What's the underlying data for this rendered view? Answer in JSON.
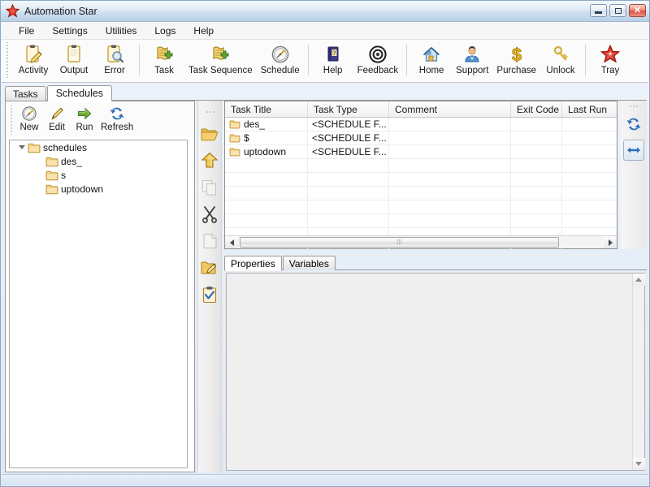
{
  "window": {
    "title": "Automation Star",
    "app_icon": "red-star-icon",
    "buttons": {
      "minimize": "minimize-icon",
      "maximize": "maximize-icon",
      "close": "close-icon"
    }
  },
  "menubar": {
    "items": [
      {
        "label": "File"
      },
      {
        "label": "Settings"
      },
      {
        "label": "Utilities"
      },
      {
        "label": "Logs"
      },
      {
        "label": "Help"
      }
    ]
  },
  "toolbar": {
    "groups": [
      {
        "buttons": [
          {
            "label": "Activity",
            "icon": "clipboard-pencil-icon"
          },
          {
            "label": "Output",
            "icon": "clipboard-icon"
          },
          {
            "label": "Error",
            "icon": "clipboard-magnifier-icon"
          }
        ]
      },
      {
        "buttons": [
          {
            "label": "Task",
            "icon": "new-task-icon"
          },
          {
            "label": "Task Sequence",
            "icon": "new-task-sequence-icon"
          },
          {
            "label": "Schedule",
            "icon": "schedule-clock-icon"
          }
        ]
      },
      {
        "buttons": [
          {
            "label": "Help",
            "icon": "help-book-icon"
          },
          {
            "label": "Feedback",
            "icon": "feedback-target-icon"
          }
        ]
      },
      {
        "buttons": [
          {
            "label": "Home",
            "icon": "home-icon"
          },
          {
            "label": "Support",
            "icon": "support-person-icon"
          },
          {
            "label": "Purchase",
            "icon": "dollar-icon"
          },
          {
            "label": "Unlock",
            "icon": "key-icon"
          }
        ]
      },
      {
        "buttons": [
          {
            "label": "Tray",
            "icon": "red-star-icon"
          }
        ]
      }
    ]
  },
  "main_tabs": {
    "items": [
      {
        "label": "Tasks",
        "active": false
      },
      {
        "label": "Schedules",
        "active": true
      }
    ]
  },
  "tree_panel": {
    "toolbar": [
      {
        "label": "New",
        "icon": "schedule-clock-icon"
      },
      {
        "label": "Edit",
        "icon": "pencil-icon"
      },
      {
        "label": "Run",
        "icon": "green-arrow-right-icon"
      },
      {
        "label": "Refresh",
        "icon": "blue-refresh-icon"
      }
    ],
    "tree": {
      "root": {
        "label": "schedules",
        "expanded": true,
        "icon": "folder-icon"
      },
      "children": [
        {
          "label": "des_",
          "icon": "folder-icon"
        },
        {
          "label": "s",
          "icon": "folder-icon"
        },
        {
          "label": "uptodown",
          "icon": "folder-icon"
        }
      ]
    }
  },
  "vertical_toolstrip": {
    "buttons": [
      {
        "name": "open-folder",
        "icon": "folder-open-icon",
        "enabled": true
      },
      {
        "name": "move-up",
        "icon": "yellow-up-arrow-icon",
        "enabled": true
      },
      {
        "name": "copy",
        "icon": "copy-pages-icon",
        "enabled": false
      },
      {
        "name": "cut",
        "icon": "scissors-icon",
        "enabled": true
      },
      {
        "name": "paste",
        "icon": "paste-page-icon",
        "enabled": false
      },
      {
        "name": "rename-folder",
        "icon": "folder-edit-icon",
        "enabled": true
      },
      {
        "name": "checklist",
        "icon": "clipboard-check-icon",
        "enabled": true
      }
    ]
  },
  "grid": {
    "columns": [
      "Task Title",
      "Task Type",
      "Comment",
      "Exit Code",
      "Last Run"
    ],
    "rows": [
      {
        "task_title": "des_",
        "task_type": "<SCHEDULE F...",
        "comment": "",
        "exit_code": "",
        "last_run": "",
        "icon": "folder-icon"
      },
      {
        "task_title": "$",
        "task_type": "<SCHEDULE F...",
        "comment": "",
        "exit_code": "",
        "last_run": "",
        "icon": "folder-icon"
      },
      {
        "task_title": "uptodown",
        "task_type": "<SCHEDULE F...",
        "comment": "",
        "exit_code": "",
        "last_run": "",
        "icon": "folder-icon"
      }
    ],
    "hscrollbar": {
      "left_arrow": "triangle-left-icon",
      "right_arrow": "triangle-right-icon",
      "thumb_grip": "⁞⁞⁞"
    }
  },
  "grid_toolstrip": {
    "buttons": [
      {
        "name": "refresh-grid",
        "icon": "blue-refresh-icon",
        "enabled": true
      },
      {
        "name": "autofit-columns",
        "icon": "blue-resize-width-icon",
        "enabled": true,
        "pressed": true
      }
    ]
  },
  "properties_panel": {
    "tabs": [
      {
        "label": "Properties",
        "active": true
      },
      {
        "label": "Variables",
        "active": false
      }
    ],
    "content": "",
    "scrollbar": {
      "up_arrow": "triangle-up-icon",
      "down_arrow": "triangle-down-icon"
    }
  },
  "statusbar": {
    "text": ""
  },
  "colors": {
    "title_gradient_top": "#f4f8fc",
    "title_gradient_bottom": "#b9cfe6",
    "accent_red": "#d9291c",
    "folder_yellow": "#f0c04a",
    "blue_accent": "#2a6fbd",
    "green_arrow": "#6aa832",
    "panel_bg": "#efefef"
  }
}
